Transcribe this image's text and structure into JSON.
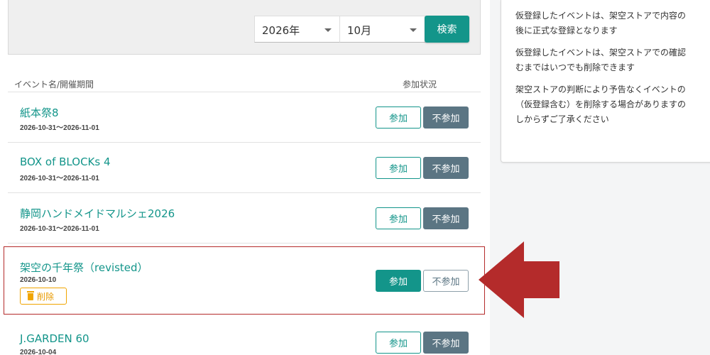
{
  "search": {
    "year": "2026年",
    "month": "10月",
    "button_label": "検索"
  },
  "list_header": {
    "name_col": "イベント名/開催期間",
    "status_col": "参加状況"
  },
  "events": [
    {
      "name": "紙本祭8",
      "date": "2026-10-31～2026-11-01",
      "join_label": "参加",
      "decline_label": "不参加"
    },
    {
      "name": "BOX of BLOCKs 4",
      "date": "2026-10-31～2026-11-01",
      "join_label": "参加",
      "decline_label": "不参加"
    },
    {
      "name": "静岡ハンドメイドマルシェ2026",
      "date": "2026-10-31～2026-11-01",
      "join_label": "参加",
      "decline_label": "不参加"
    },
    {
      "name": "架空の千年祭（revisted）",
      "date": "2026-10-10",
      "join_label": "参加",
      "decline_label": "不参加",
      "delete_label": "削除"
    },
    {
      "name": "J.GARDEN 60",
      "date": "2026-10-04",
      "join_label": "参加",
      "decline_label": "不参加"
    }
  ],
  "notice": {
    "line1a": "仮登録したイベントは、架空ストアで内容の",
    "line1b": "後に正式な登録となります",
    "line2a": "仮登録したイベントは、架空ストアでの確認",
    "line2b": "むまではいつでも削除できます",
    "line3a": "架空ストアの判断により予告なくイベントの",
    "line3b": "（仮登録含む）を削除する場合がありますの",
    "line3c": "しからずご了承ください"
  },
  "colors": {
    "accent_teal": "#13958a",
    "slate": "#5b7583",
    "highlight_border": "#b42b2b",
    "arrow": "#b42b2b",
    "delete_orange": "#f0a500"
  }
}
